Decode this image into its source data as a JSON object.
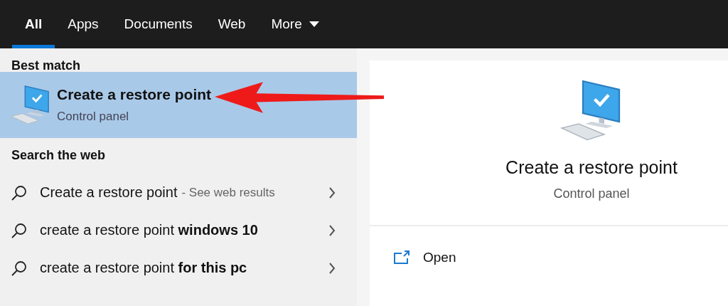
{
  "tabs": [
    {
      "label": "All",
      "selected": true
    },
    {
      "label": "Apps",
      "selected": false
    },
    {
      "label": "Documents",
      "selected": false
    },
    {
      "label": "Web",
      "selected": false
    },
    {
      "label": "More",
      "selected": false,
      "dropdown": true
    }
  ],
  "best_match": {
    "heading": "Best match",
    "title": "Create a restore point",
    "subtitle": "Control panel",
    "selected": true
  },
  "search_the_web": {
    "heading": "Search the web",
    "items": [
      {
        "text": "Create a restore point",
        "hint": "- See web results"
      },
      {
        "text": "create a restore point **windows 10**"
      },
      {
        "text": "create a restore point **for this pc**"
      }
    ]
  },
  "preview": {
    "title": "Create a restore point",
    "subtitle": "Control panel",
    "actions": [
      {
        "label": "Open"
      }
    ]
  }
}
